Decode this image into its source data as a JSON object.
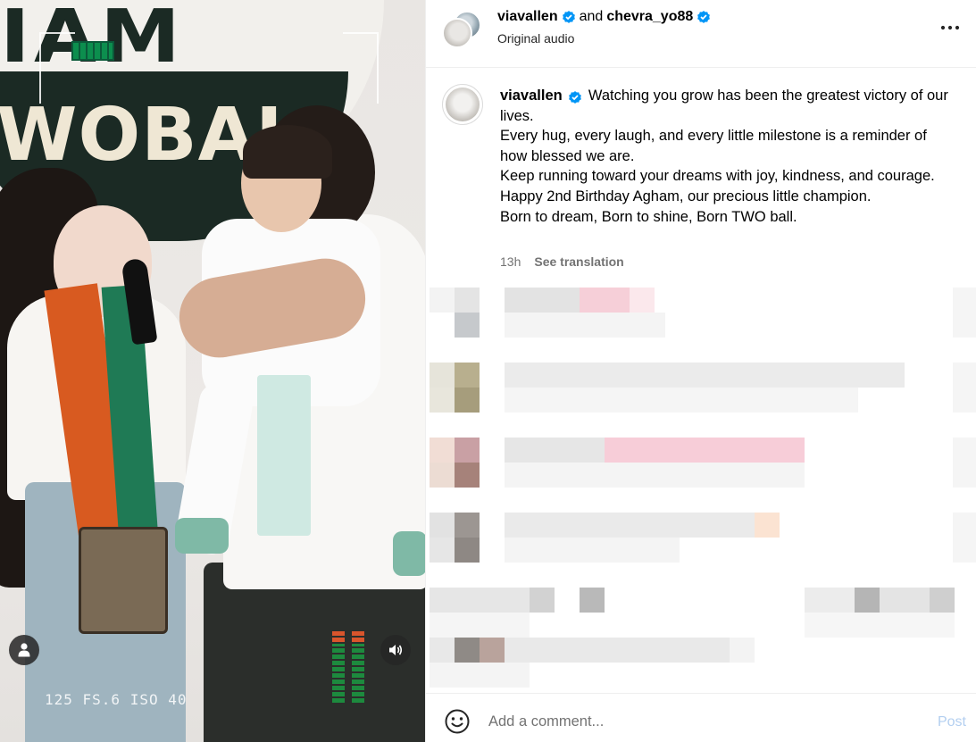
{
  "header": {
    "user1": "viavallen",
    "connector": "and",
    "user2": "chevra_yo88",
    "subtitle": "Original audio",
    "more_icon": "more-horizontal-icon"
  },
  "media": {
    "banner_top_text": "IAM",
    "banner_mid_text": "WOBAL",
    "hud_text": "125  FS.6  ISO 40",
    "user_icon": "user-icon",
    "audio_icon": "speaker-icon",
    "colors": {
      "banner_dark": "#1b2a24",
      "banner_letters": "#efe7d4"
    }
  },
  "caption": {
    "username": "viavallen",
    "lines": [
      "Watching you grow has been the greatest victory of our lives.",
      "Every hug, every laugh, and every little milestone is a reminder of how blessed we are.",
      "Keep running toward your dreams with joy, kindness, and courage.",
      "Happy 2nd Birthday Agham, our precious little champion.",
      "Born to dream, Born to shine, Born TWO ball."
    ],
    "time": "13h",
    "see_translation": "See translation"
  },
  "comment_box": {
    "placeholder": "Add a comment...",
    "post_label": "Post",
    "emoji_icon": "emoji-smile-icon"
  },
  "colors": {
    "verified_blue": "#0095f6",
    "post_disabled": "#b3cff0",
    "secondary_text": "#737373"
  }
}
